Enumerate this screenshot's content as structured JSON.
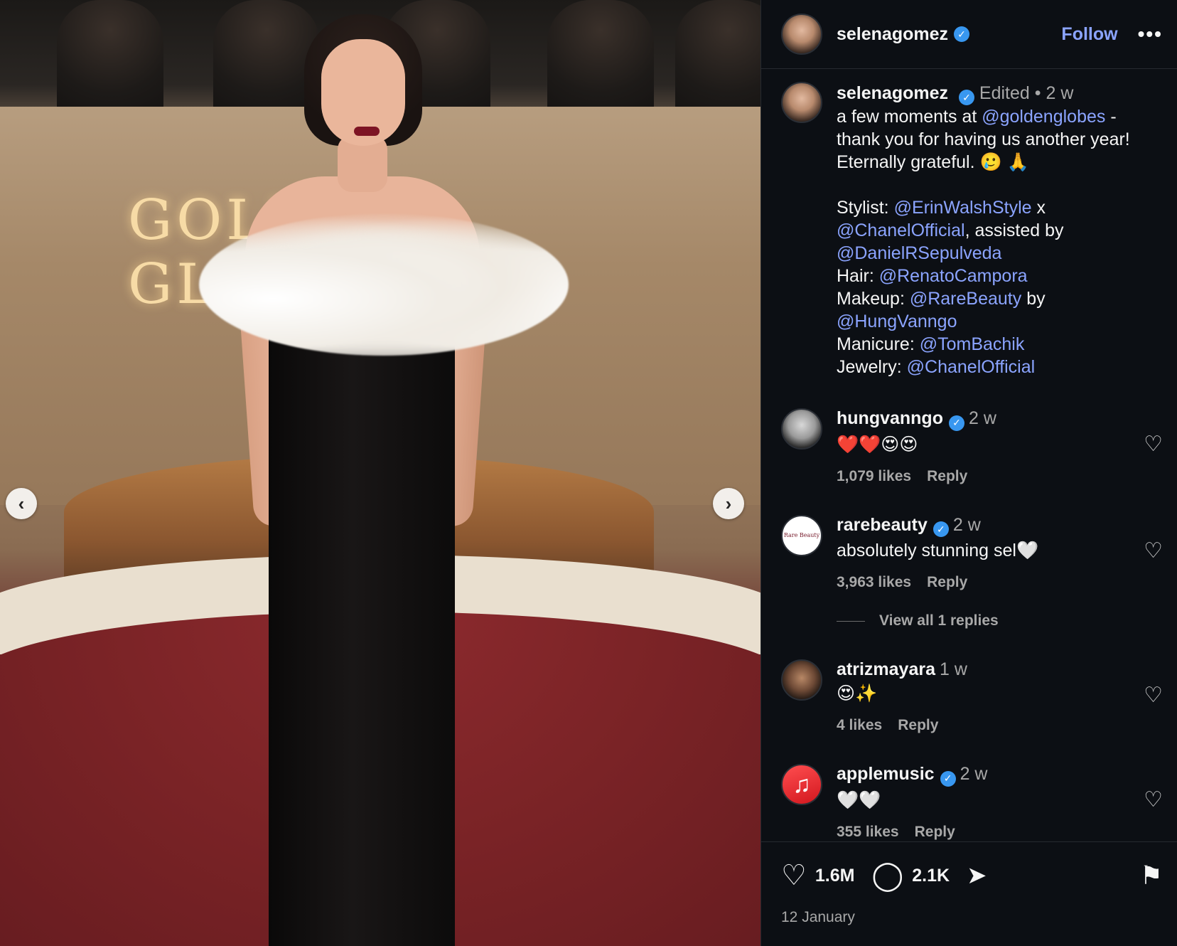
{
  "post": {
    "author": "selenagomez",
    "follow_label": "Follow",
    "more_label": "•••"
  },
  "photo": {
    "wall_text": "GOLDEN GLOBES",
    "prev_label": "‹",
    "next_label": "›"
  },
  "caption": {
    "username": "selenagomez",
    "edited": "Edited",
    "separator": "•",
    "time": "2 w",
    "lines": [
      {
        "pre": "a few moments at ",
        "link": "@goldenglobes",
        "post": " -"
      },
      {
        "pre": "thank you for having us another year!",
        "link": "",
        "post": ""
      },
      {
        "pre": "Eternally grateful. 🥲 🙏",
        "link": "",
        "post": ""
      },
      {
        "pre": "",
        "link": "",
        "post": ""
      },
      {
        "pre": "Stylist: ",
        "link": "@ErinWalshStyle",
        "post": " x"
      },
      {
        "pre": "",
        "link": "@ChanelOfficial",
        "post": ", assisted by"
      },
      {
        "pre": "",
        "link": "@DanielRSepulveda",
        "post": ""
      },
      {
        "pre": "Hair: ",
        "link": "@RenatoCampora",
        "post": ""
      },
      {
        "pre": "Makeup: ",
        "link": "@RareBeauty",
        "post": " by"
      },
      {
        "pre": "",
        "link": "@HungVanngo",
        "post": ""
      },
      {
        "pre": "Manicure: ",
        "link": "@TomBachik",
        "post": ""
      },
      {
        "pre": "Jewelry: ",
        "link": "@ChanelOfficial",
        "post": ""
      }
    ]
  },
  "comments": [
    {
      "username": "hungvanngo",
      "verified": true,
      "time": "2 w",
      "text": "❤️❤️😍😍",
      "likes": "1,079 likes",
      "reply": "Reply"
    },
    {
      "username": "rarebeauty",
      "verified": true,
      "time": "2 w",
      "text": "absolutely stunning sel🤍",
      "likes": "3,963 likes",
      "reply": "Reply",
      "avatar_text": "Rare Beauty"
    },
    {
      "username": "atrizmayara",
      "verified": false,
      "time": "1 w",
      "text": "😍✨",
      "likes": "4 likes",
      "reply": "Reply"
    },
    {
      "username": "applemusic",
      "verified": true,
      "time": "2 w",
      "text": "🤍🤍",
      "likes": "355 likes",
      "reply": "Reply"
    }
  ],
  "view_replies": "View all 1 replies",
  "footer": {
    "likes": "1.6M",
    "comments": "2.1K",
    "date": "12 January"
  },
  "icons": {
    "verified": "✓",
    "heart": "♡",
    "comment": "◯",
    "share": "➤",
    "bookmark": "⚑",
    "music": "♫"
  }
}
